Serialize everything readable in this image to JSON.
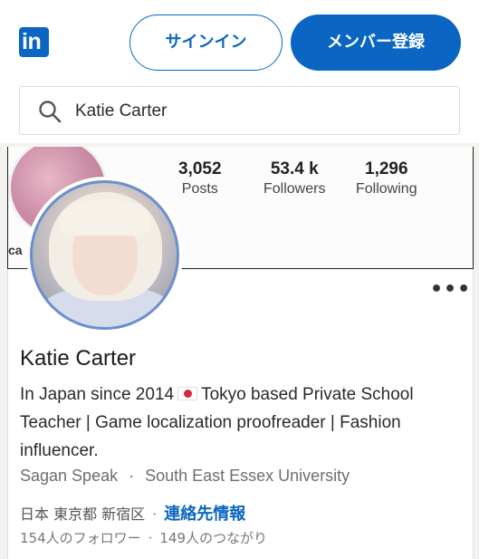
{
  "header": {
    "logo_text": "in",
    "signin_label": "サインイン",
    "join_label": "メンバー登録"
  },
  "search": {
    "value": "Katie Carter"
  },
  "cover": {
    "handle_partial": "ca",
    "stats": [
      {
        "value": "3,052",
        "label": "Posts"
      },
      {
        "value": "53.4 k",
        "label": "Followers"
      },
      {
        "value": "1,296",
        "label": "Following"
      }
    ]
  },
  "profile": {
    "name": "Katie Carter",
    "headline_part1": "In Japan since 2014",
    "headline_part2": "Tokyo based Private School Teacher | Game localization proofreader | Fashion influencer.",
    "company": "Sagan Speak",
    "school": "South East Essex University",
    "location": "日本 東京都 新宿区",
    "contact_label": "連絡先情報",
    "followers": "154人のフォロワー",
    "connections": "149人のつながり",
    "more_label": "•••"
  },
  "colors": {
    "brand": "#0a66c2",
    "text": "#1d1d1d",
    "muted": "#6e6e6e",
    "page_bg": "#f4f2ee"
  }
}
